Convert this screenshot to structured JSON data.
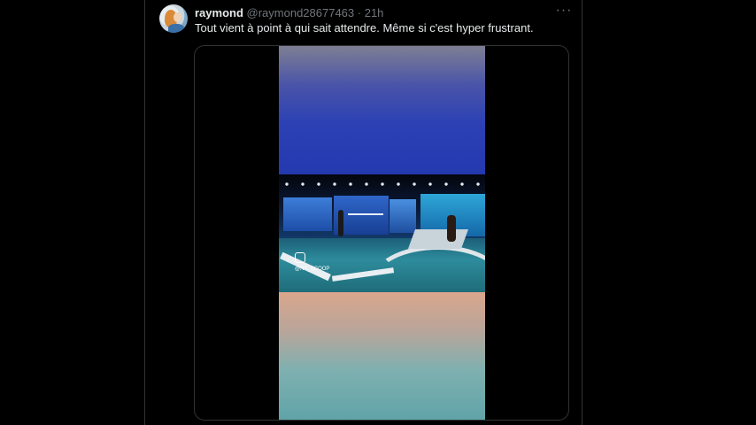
{
  "tweet": {
    "author_name": "raymond",
    "author_handle": "@raymond28677463",
    "separator": " · ",
    "time": "21h",
    "text": "Tout vient à point à qui sait attendre. Même si c'est hyper frustrant.",
    "more_icon": "more-horizontal-icon"
  },
  "media": {
    "watermark": "@NY_SCOOP"
  }
}
